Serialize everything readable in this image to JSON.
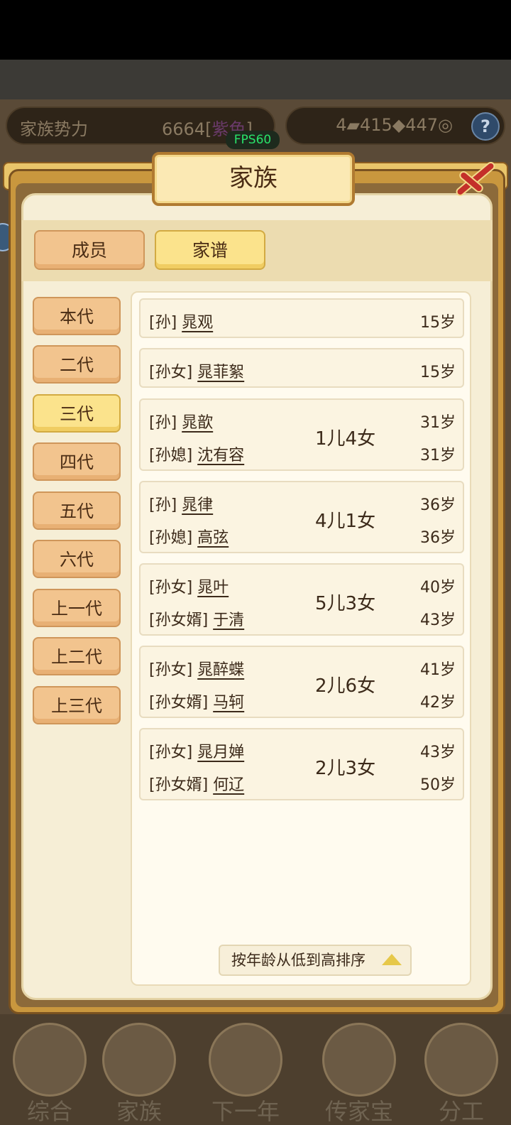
{
  "hud": {
    "power_label": "家族势力",
    "power_value": "6664",
    "power_tag_open": "[",
    "power_tag": "紫色",
    "power_tag_close": "]",
    "res_a": "4",
    "res_b": "415",
    "res_c": "447",
    "help": "?"
  },
  "fps": "FPS60",
  "dialog": {
    "title": "家族",
    "tabs": [
      {
        "label": "成员",
        "active": false
      },
      {
        "label": "家谱",
        "active": true
      }
    ],
    "generations": [
      {
        "label": "本代",
        "active": false
      },
      {
        "label": "二代",
        "active": false
      },
      {
        "label": "三代",
        "active": true
      },
      {
        "label": "四代",
        "active": false
      },
      {
        "label": "五代",
        "active": false
      },
      {
        "label": "六代",
        "active": false
      },
      {
        "label": "上一代",
        "active": false
      },
      {
        "label": "上二代",
        "active": false
      },
      {
        "label": "上三代",
        "active": false
      }
    ],
    "rows": [
      {
        "lines": [
          {
            "role": "[孙]",
            "name": "晁观",
            "age": "15岁"
          }
        ],
        "kids": ""
      },
      {
        "lines": [
          {
            "role": "[孙女]",
            "name": "晁菲絮",
            "age": "15岁"
          }
        ],
        "kids": ""
      },
      {
        "lines": [
          {
            "role": "[孙]",
            "name": "晁歆",
            "age": "31岁"
          },
          {
            "role": "[孙媳]",
            "name": "沈有容",
            "age": "31岁"
          }
        ],
        "kids": "1儿4女"
      },
      {
        "lines": [
          {
            "role": "[孙]",
            "name": "晁律",
            "age": "36岁"
          },
          {
            "role": "[孙媳]",
            "name": "高弦",
            "age": "36岁"
          }
        ],
        "kids": "4儿1女"
      },
      {
        "lines": [
          {
            "role": "[孙女]",
            "name": "晁叶",
            "age": "40岁"
          },
          {
            "role": "[孙女婿]",
            "name": "于清",
            "age": "43岁"
          }
        ],
        "kids": "5儿3女"
      },
      {
        "lines": [
          {
            "role": "[孙女]",
            "name": "晁醉蝶",
            "age": "41岁"
          },
          {
            "role": "[孙女婿]",
            "name": "马轲",
            "age": "42岁"
          }
        ],
        "kids": "2儿6女"
      },
      {
        "lines": [
          {
            "role": "[孙女]",
            "name": "晁月婵",
            "age": "43岁"
          },
          {
            "role": "[孙女婿]",
            "name": "何辽",
            "age": "50岁"
          }
        ],
        "kids": "2儿3女"
      }
    ],
    "sort_label": "按年龄从低到高排序"
  },
  "bottom_nav": [
    {
      "label": "综合"
    },
    {
      "label": "家族"
    },
    {
      "label": "下一年"
    },
    {
      "label": "传家宝"
    },
    {
      "label": "分工"
    }
  ]
}
